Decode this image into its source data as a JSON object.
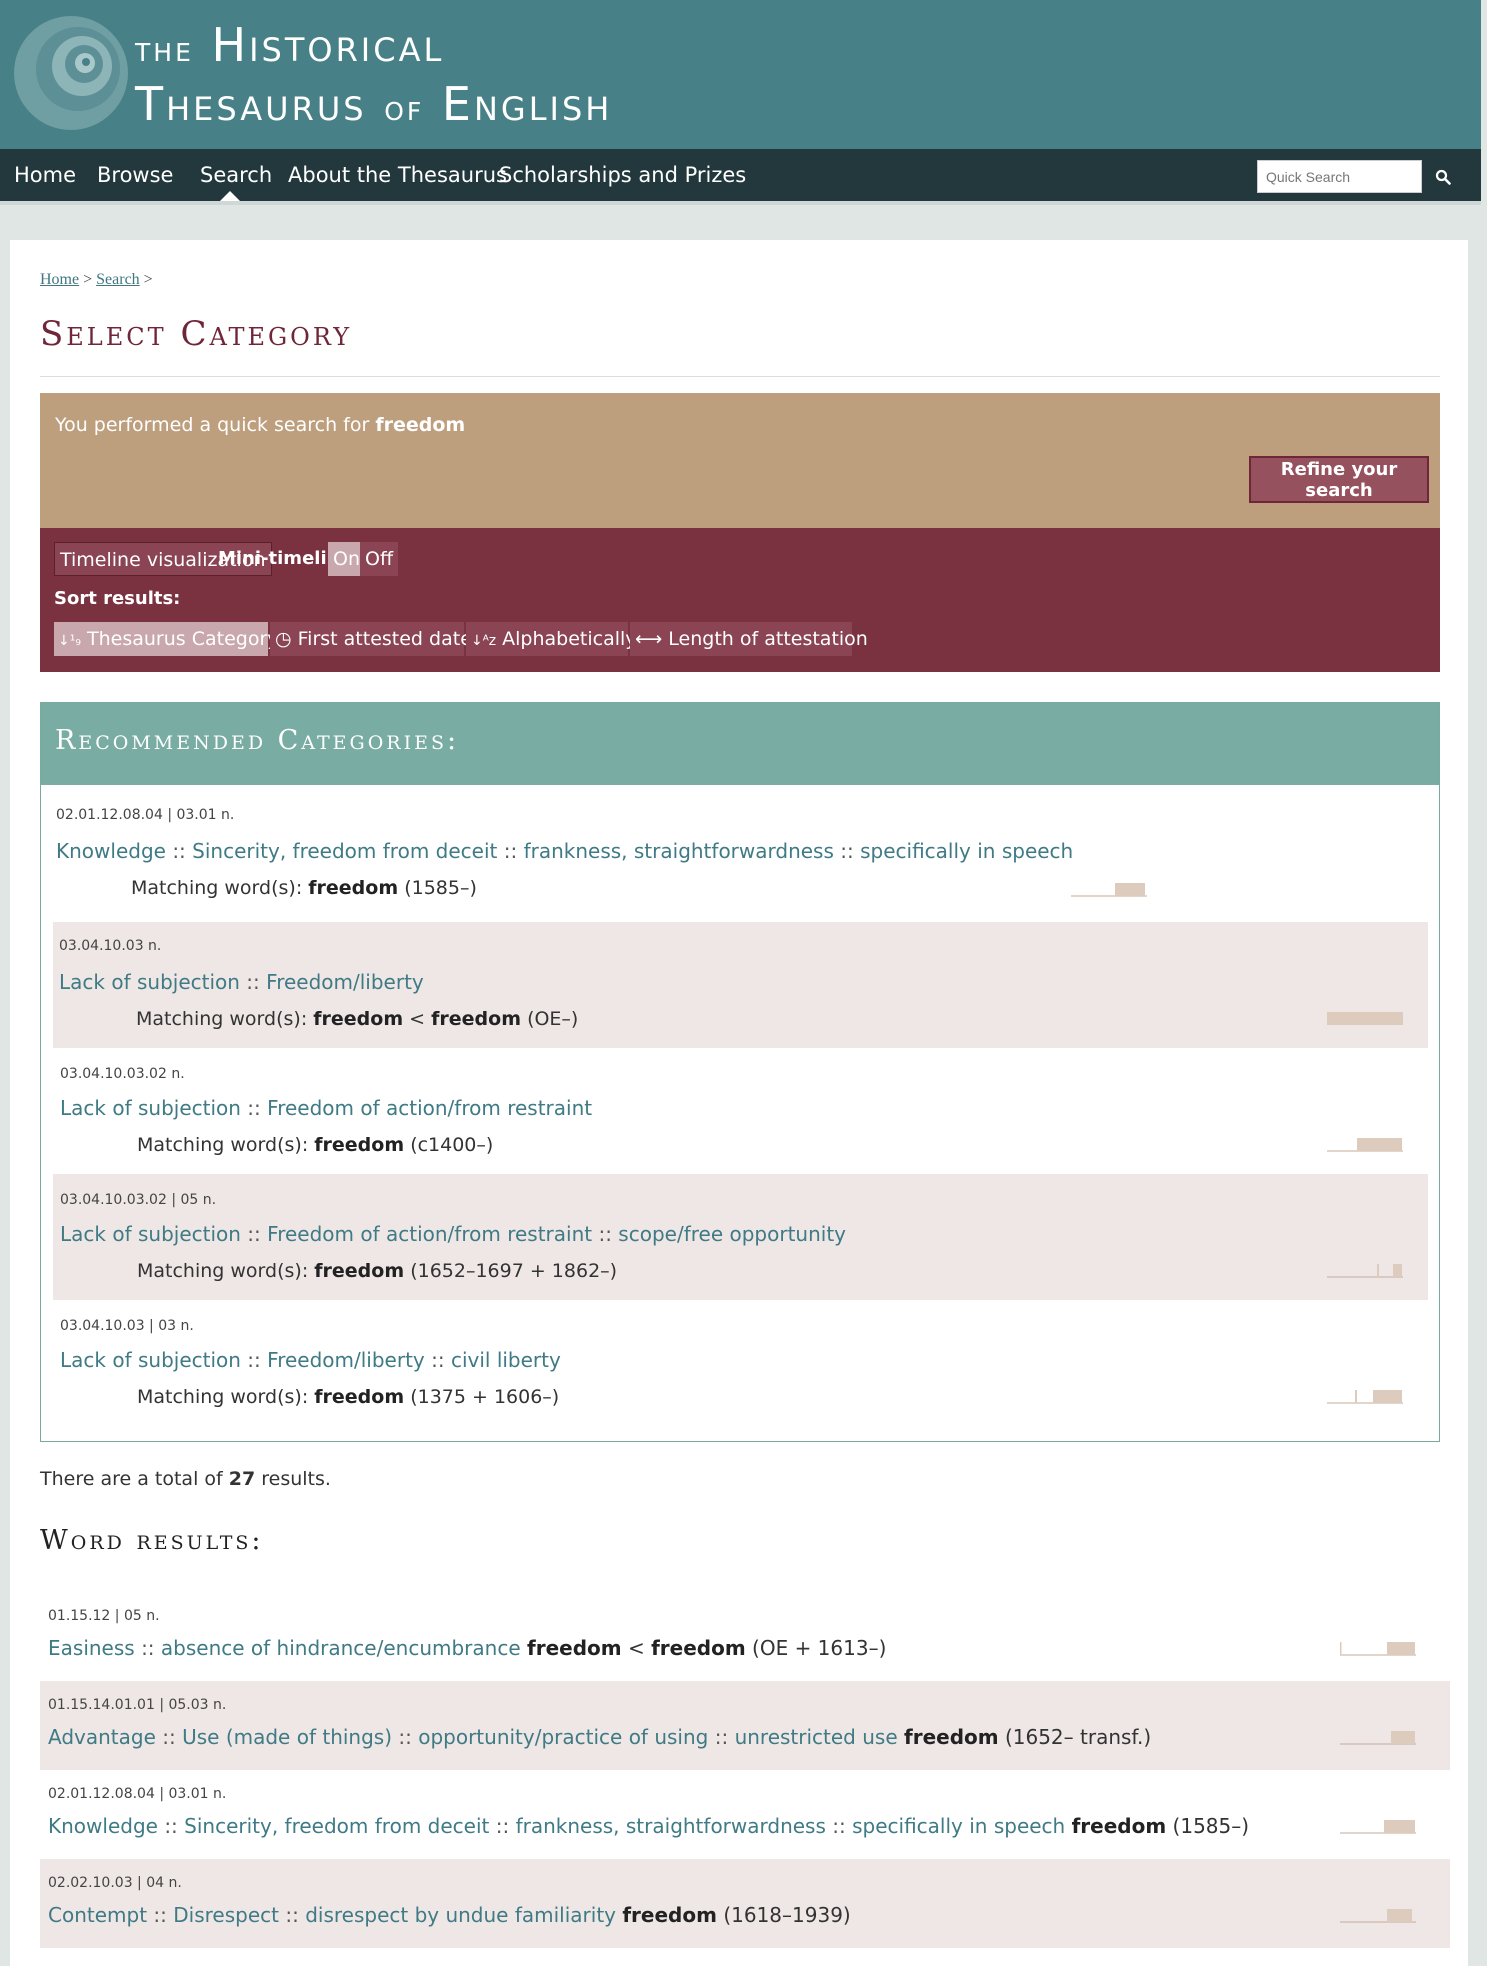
{
  "site": {
    "title_line1_prefix": "The",
    "title_line1_main": "Historical",
    "title_line2_main": "Thesaurus",
    "title_line2_of": "of",
    "title_line2_end": "English"
  },
  "nav": {
    "home": "Home",
    "browse": "Browse",
    "search": "Search",
    "about": "About the Thesaurus",
    "scholarships": "Scholarships and Prizes",
    "quick_search_placeholder": "Quick Search"
  },
  "breadcrumb": {
    "home": "Home",
    "search": "Search",
    "sep": ">"
  },
  "page_title": "Select Category",
  "search_box": {
    "prefix": "You performed a quick search for ",
    "term": "freedom",
    "refine_label": "Refine your search"
  },
  "controls": {
    "timeline_btn": "Timeline visualization",
    "mini_label": "Mini-timelines:",
    "on": "On",
    "off": "Off",
    "sort_label": "Sort results:",
    "sort_category": "Thesaurus Category",
    "sort_first": "First attested date",
    "sort_alpha": "Alphabetically",
    "sort_length": "Length of attestation"
  },
  "recommended": {
    "title": "Recommended Categories:",
    "matching_label": "Matching word(s): ",
    "items": [
      {
        "code": "02.01.12.08.04 | 03.01 n.",
        "path": [
          "Knowledge",
          "Sincerity, freedom from deceit",
          "frankness, straightforwardness",
          "specifically in speech"
        ],
        "word": "freedom",
        "word2": "",
        "dates": "(1585–)"
      },
      {
        "code": "03.04.10.03 n.",
        "path": [
          "Lack of subjection",
          "Freedom/liberty"
        ],
        "word": "freedom",
        "word2": "freedom",
        "dates": "(OE–)"
      },
      {
        "code": "03.04.10.03.02 n.",
        "path": [
          "Lack of subjection",
          "Freedom of action/from restraint"
        ],
        "word": "freedom",
        "word2": "",
        "dates": "(c1400–)"
      },
      {
        "code": "03.04.10.03.02 | 05 n.",
        "path": [
          "Lack of subjection",
          "Freedom of action/from restraint",
          "scope/free opportunity"
        ],
        "word": "freedom",
        "word2": "",
        "dates": "(1652–1697 + 1862–)"
      },
      {
        "code": "03.04.10.03 | 03 n.",
        "path": [
          "Lack of subjection",
          "Freedom/liberty",
          "civil liberty"
        ],
        "word": "freedom",
        "word2": "",
        "dates": "(1375 + 1606–)"
      }
    ]
  },
  "total": {
    "prefix": "There are a total of ",
    "count": "27",
    "suffix": " results."
  },
  "word_results": {
    "title": "Word results:",
    "items": [
      {
        "code": "01.15.12 | 05 n.",
        "path": [
          "Easiness",
          "absence of hindrance/encumbrance"
        ],
        "word": "freedom",
        "word2": "freedom",
        "dates": "(OE + 1613–)"
      },
      {
        "code": "01.15.14.01.01 | 05.03 n.",
        "path": [
          "Advantage",
          "Use (made of things)",
          "opportunity/practice of using",
          "unrestricted use"
        ],
        "word": "freedom",
        "word2": "",
        "dates": "(1652– transf.)"
      },
      {
        "code": "02.01.12.08.04 | 03.01 n.",
        "path": [
          "Knowledge",
          "Sincerity, freedom from deceit",
          "frankness, straightforwardness",
          "specifically in speech"
        ],
        "word": "freedom",
        "word2": "",
        "dates": "(1585–)"
      },
      {
        "code": "02.02.10.03 | 04 n.",
        "path": [
          "Contempt",
          "Disrespect",
          "disrespect by undue familiarity"
        ],
        "word": "freedom",
        "word2": "",
        "dates": "(1618–1939)"
      }
    ]
  },
  "colors": {
    "header": "#478087",
    "nav": "#23383d",
    "title_maroon": "#6e2638",
    "tan": "#bd9e7d",
    "controls": "#7a3240",
    "recommended": "#79aca2",
    "link_teal": "#3f7a85",
    "timeline_fill": "#ddcbbd"
  }
}
